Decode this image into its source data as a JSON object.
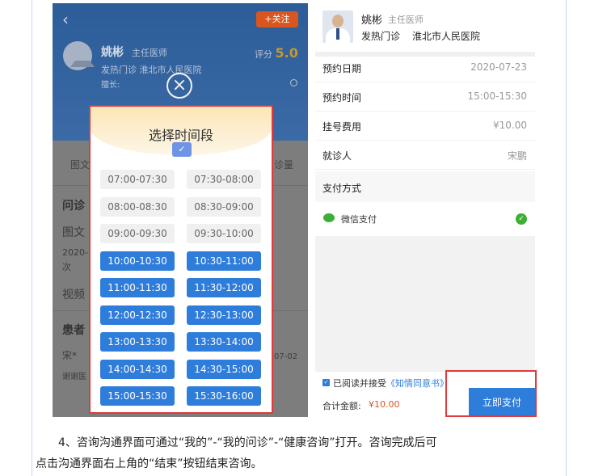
{
  "left": {
    "follow_label": "+关注",
    "doctor_name": "姚彬",
    "doctor_title": "主任医师",
    "score_label": "评分",
    "score_value": "5.0",
    "dept_hospital": "发热门诊 淮北市人民医院",
    "good_at": "擅长:",
    "behind_tab_left": "图文",
    "behind_tab_right": "诊量",
    "behind_section1": "问诊",
    "behind_item1": "图文",
    "behind_item2a": "2020-",
    "behind_item2b": "次",
    "behind_item3": "视频",
    "behind_section2": "患者",
    "behind_item4": "宋*",
    "behind_item4_date": "07-02",
    "behind_item5": "谢谢医",
    "modal_title": "选择时间段",
    "slots": [
      {
        "label": "07:00-07:30",
        "available": false
      },
      {
        "label": "07:30-08:00",
        "available": false
      },
      {
        "label": "08:00-08:30",
        "available": false
      },
      {
        "label": "08:30-09:00",
        "available": false
      },
      {
        "label": "09:00-09:30",
        "available": false
      },
      {
        "label": "09:30-10:00",
        "available": false
      },
      {
        "label": "10:00-10:30",
        "available": true
      },
      {
        "label": "10:30-11:00",
        "available": true
      },
      {
        "label": "11:00-11:30",
        "available": true
      },
      {
        "label": "11:30-12:00",
        "available": true
      },
      {
        "label": "12:00-12:30",
        "available": true
      },
      {
        "label": "12:30-13:00",
        "available": true
      },
      {
        "label": "13:00-13:30",
        "available": true
      },
      {
        "label": "13:30-14:00",
        "available": true
      },
      {
        "label": "14:00-14:30",
        "available": true
      },
      {
        "label": "14:30-15:00",
        "available": true
      },
      {
        "label": "15:00-15:30",
        "available": true
      },
      {
        "label": "15:30-16:00",
        "available": true
      }
    ]
  },
  "right": {
    "doctor_name": "姚彬",
    "doctor_title": "主任医师",
    "dept": "发热门诊",
    "hospital": "淮北市人民医院",
    "rows": [
      {
        "label": "预约日期",
        "value": "2020-07-23"
      },
      {
        "label": "预约时间",
        "value": "15:00-15:30"
      },
      {
        "label": "挂号费用",
        "value": "¥10.00"
      },
      {
        "label": "就诊人",
        "value": "宋鹏"
      }
    ],
    "pay_method_label": "支付方式",
    "wechat_label": "微信支付",
    "agree_text": "已阅读并接受",
    "agree_link": "《知情同意书》",
    "total_label": "合计金额:",
    "total_value": "¥10.00",
    "pay_button": "立即支付"
  },
  "caption": {
    "line1": "4、咨询沟通界面可通过“我的”-“我的问诊”-“健康咨询”打开。咨询完成后可",
    "line2": "点击沟通界面右上角的“结束”按钮结束咨询。"
  },
  "colors": {
    "accent_blue": "#2f7ddb",
    "highlight_red": "#e03a3a",
    "wechat_green": "#3cb034",
    "price_orange": "#d9561f"
  }
}
